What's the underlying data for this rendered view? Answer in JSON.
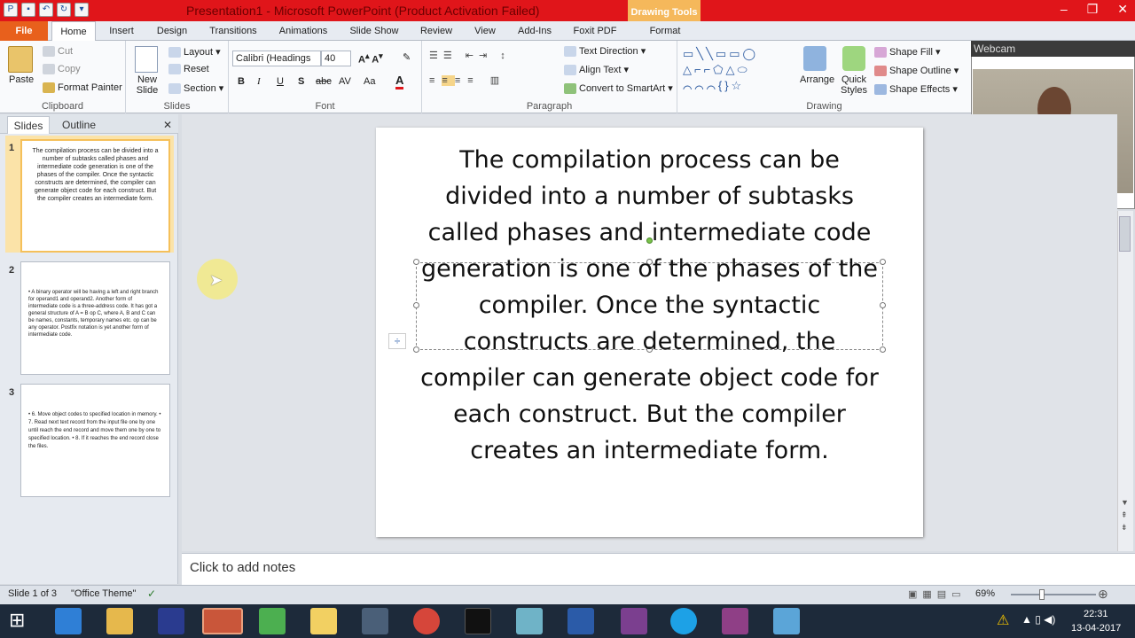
{
  "window": {
    "title": "Presentation1 - Microsoft PowerPoint (Product Activation Failed)",
    "context_tab": "Drawing Tools"
  },
  "tabs": [
    "File",
    "Home",
    "Insert",
    "Design",
    "Transitions",
    "Animations",
    "Slide Show",
    "Review",
    "View",
    "Add-Ins",
    "Foxit PDF",
    "Format"
  ],
  "ribbon": {
    "clipboard": {
      "label": "Clipboard",
      "paste": "Paste",
      "cut": "Cut",
      "copy": "Copy",
      "format_painter": "Format Painter"
    },
    "slides": {
      "label": "Slides",
      "new_slide": "New Slide",
      "layout": "Layout",
      "reset": "Reset",
      "section": "Section"
    },
    "font": {
      "label": "Font",
      "font_name": "Calibri (Headings",
      "font_size": "40",
      "bold": "B",
      "italic": "I",
      "underline": "U",
      "shadow": "S",
      "strike": "abc",
      "spacing": "AV",
      "case": "Aa",
      "color": "A"
    },
    "paragraph": {
      "label": "Paragraph",
      "text_direction": "Text Direction",
      "align_text": "Align Text",
      "smartart": "Convert to SmartArt"
    },
    "drawing": {
      "label": "Drawing",
      "arrange": "Arrange",
      "quick_styles": "Quick Styles",
      "shape_fill": "Shape Fill",
      "shape_outline": "Shape Outline",
      "shape_effects": "Shape Effects"
    }
  },
  "webcam": {
    "title": "Webcam"
  },
  "pane": {
    "tab_slides": "Slides",
    "tab_outline": "Outline"
  },
  "thumbnails": [
    {
      "num": "1",
      "text": "The compilation process can be divided into a number of subtasks called phases and intermediate code generation is one of the phases of the compiler. Once the syntactic constructs are determined, the compiler can generate object code for each construct. But the compiler creates an intermediate form."
    },
    {
      "num": "2",
      "text": "• A binary operator will be having a left and right branch for operand1 and operand2. Another form of intermediate code is a three-address code. It has got a general structure of A = B op C, where A, B and C can be names, constants, temporary names etc. op can be any operator. Postfix notation is yet another form of intermediate code."
    },
    {
      "num": "3",
      "text": "• 6. Move object codes to specified location in memory. • 7. Read next text record from the input file one by one until reach the end record and move them one by one to specified location. • 8. If it reaches the end record close the files."
    }
  ],
  "slide": {
    "body": "The compilation process can be divided into a number of subtasks called phases and intermediate code generation is one of the phases of the compiler. Once the syntactic constructs are determined, the compiler can generate object code for each construct. But the compiler creates an intermediate form."
  },
  "notes": {
    "placeholder": "Click to add notes"
  },
  "status": {
    "slide_info": "Slide 1 of 3",
    "theme": "\"Office Theme\"",
    "zoom": "69%"
  },
  "clock": {
    "time": "22:31",
    "date": "13-04-2017"
  }
}
